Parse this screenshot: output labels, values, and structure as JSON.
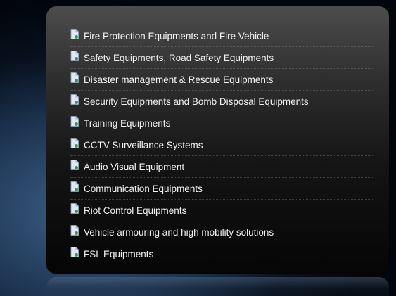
{
  "menu": {
    "items": [
      {
        "label": "Fire Protection Equipments and Fire Vehicle",
        "icon": "document-icon"
      },
      {
        "label": "Safety Equipments, Road Safety Equipments",
        "icon": "document-icon"
      },
      {
        "label": "Disaster management & Rescue Equipments",
        "icon": "document-icon"
      },
      {
        "label": "Security Equipments and Bomb Disposal Equipments",
        "icon": "document-icon"
      },
      {
        "label": "Training Equipments",
        "icon": "document-icon"
      },
      {
        "label": "CCTV Surveillance Systems",
        "icon": "document-icon"
      },
      {
        "label": "Audio Visual Equipment",
        "icon": "document-icon"
      },
      {
        "label": "Communication Equipments",
        "icon": "document-icon"
      },
      {
        "label": "Riot Control Equipments",
        "icon": "document-icon"
      },
      {
        "label": "Vehicle armouring and high mobility solutions",
        "icon": "document-icon"
      },
      {
        "label": "FSL Equipments",
        "icon": "document-icon"
      }
    ]
  },
  "colors": {
    "panel_top": "#4c4c4c",
    "panel_bottom": "#050505",
    "text": "#f2f2f2",
    "background_glow": "#3d5f86"
  }
}
